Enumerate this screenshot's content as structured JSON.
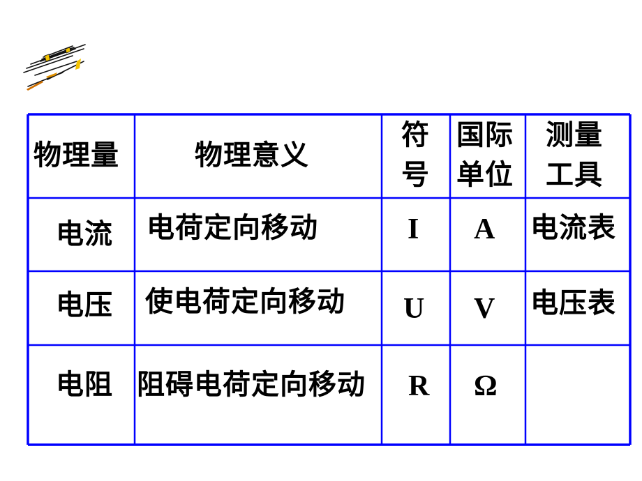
{
  "slide": {
    "logo_icon": "decorative-streak-logo-icon",
    "border_color": "#0000ff",
    "table": {
      "headers": [
        "物理量",
        "物理意义",
        "符号",
        "国际单位",
        "测量工具"
      ],
      "header_lines": {
        "symbol": [
          "符",
          "号"
        ],
        "unit": [
          "国际",
          "单位"
        ],
        "tool": [
          "测量",
          "工具"
        ]
      },
      "rows": [
        {
          "quantity": "电流",
          "meaning": "电荷定向移动",
          "symbol": "I",
          "unit": "A",
          "tool": "电流表"
        },
        {
          "quantity": "电压",
          "meaning": "使电荷定向移动",
          "symbol": "U",
          "unit": "V",
          "tool": "电压表"
        },
        {
          "quantity": "电阻",
          "meaning": "阻碍电荷定向移动",
          "symbol": "R",
          "unit": "Ω",
          "tool": ""
        }
      ]
    }
  }
}
